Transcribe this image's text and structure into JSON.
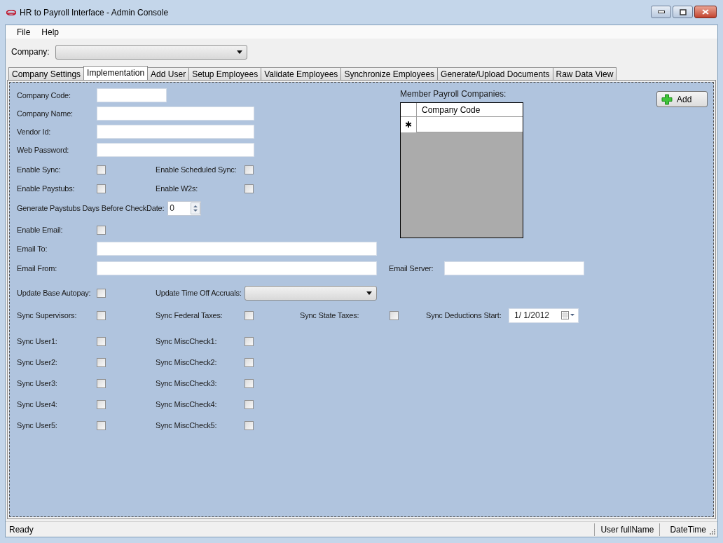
{
  "window": {
    "title": "HR to Payroll Interface - Admin Console"
  },
  "menu": [
    "File",
    "Help"
  ],
  "company": {
    "label": "Company:"
  },
  "tabs": [
    {
      "label": "Company Settings",
      "selected": false
    },
    {
      "label": "Implementation",
      "selected": true
    },
    {
      "label": "Add User",
      "selected": false
    },
    {
      "label": "Setup Employees",
      "selected": false
    },
    {
      "label": "Validate Employees",
      "selected": false
    },
    {
      "label": "Synchronize Employees",
      "selected": false
    },
    {
      "label": "Generate/Upload Documents",
      "selected": false
    },
    {
      "label": "Raw Data View",
      "selected": false
    }
  ],
  "upper_rows": [
    {
      "fields": [
        {
          "kind": "textbox",
          "label": "Company Code:"
        }
      ]
    },
    {
      "fields": [
        {
          "kind": "textbox",
          "label": "Company Name:"
        }
      ]
    },
    {
      "fields": [
        {
          "kind": "textbox",
          "label": "Vendor Id:"
        }
      ]
    },
    {
      "fields": [
        {
          "kind": "textbox",
          "label": "Web Password:"
        }
      ]
    },
    {
      "fields": [
        {
          "kind": "checkbox",
          "label": "Enable Sync:",
          "checked": false
        },
        {
          "kind": "checkbox",
          "label": "Enable Scheduled Sync:",
          "checked": false
        }
      ]
    },
    {
      "fields": [
        {
          "kind": "checkbox",
          "label": "Enable Paystubs:",
          "checked": false
        },
        {
          "kind": "checkbox",
          "label": "Enable W2s:",
          "checked": false
        }
      ]
    },
    {
      "fields": [
        {
          "kind": "spinner",
          "label": "Generate Paystubs Days Before CheckDate:",
          "value": "0"
        }
      ]
    },
    {
      "fields": [
        {
          "kind": "checkbox",
          "label": "Enable Email:",
          "checked": false
        }
      ]
    }
  ],
  "lower_rows": [
    {
      "fields": [
        {
          "kind": "textbox",
          "label": "Email To:"
        }
      ]
    },
    {
      "fields": [
        {
          "kind": "textbox",
          "label": "Email From:"
        },
        {
          "kind": "textbox",
          "label": "Email Server:"
        }
      ]
    },
    {
      "fields": [
        {
          "kind": "checkbox",
          "label": "Update Base Autopay:",
          "checked": false
        },
        {
          "kind": "combobox",
          "label": "Update Time Off Accruals:"
        }
      ]
    },
    {
      "fields": [
        {
          "kind": "checkbox",
          "label": "Sync Supervisors:",
          "checked": false
        },
        {
          "kind": "checkbox",
          "label": "Sync Federal Taxes:",
          "checked": false
        },
        {
          "kind": "checkbox",
          "label": "Sync State Taxes:",
          "checked": false
        },
        {
          "kind": "datepicker",
          "label": "Sync Deductions Start:",
          "value": "1/ 1/2012"
        }
      ]
    },
    {
      "fields": [
        {
          "kind": "checkbox",
          "label": "Sync User1:",
          "checked": false
        },
        {
          "kind": "checkbox",
          "label": "Sync MiscCheck1:",
          "checked": false
        }
      ]
    },
    {
      "fields": [
        {
          "kind": "checkbox",
          "label": "Sync User2:",
          "checked": false
        },
        {
          "kind": "checkbox",
          "label": "Sync MiscCheck2:",
          "checked": false
        }
      ]
    },
    {
      "fields": [
        {
          "kind": "checkbox",
          "label": "Sync User3:",
          "checked": false
        },
        {
          "kind": "checkbox",
          "label": "Sync MiscCheck3:",
          "checked": false
        }
      ]
    },
    {
      "fields": [
        {
          "kind": "checkbox",
          "label": "Sync User4:",
          "checked": false
        },
        {
          "kind": "checkbox",
          "label": "Sync MiscCheck4:",
          "checked": false
        }
      ]
    },
    {
      "fields": [
        {
          "kind": "checkbox",
          "label": "Sync User5:",
          "checked": false
        },
        {
          "kind": "checkbox",
          "label": "Sync MiscCheck5:",
          "checked": false
        }
      ]
    }
  ],
  "member_grid": {
    "label": "Member Payroll Companies:",
    "columns": [
      "Company Code"
    ],
    "new_row_marker": "✱"
  },
  "add_button": {
    "label": "Add"
  },
  "status_bar": {
    "message": "Ready",
    "user": "User fullName",
    "datetime": "DateTime"
  }
}
